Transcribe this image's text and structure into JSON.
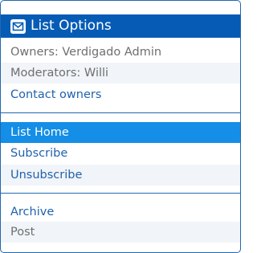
{
  "header": {
    "icon": "envelope-icon",
    "title": "List Options"
  },
  "info": {
    "owners": "Owners: Verdigado Admin",
    "moderators": "Moderators: Willi",
    "contact": "Contact owners"
  },
  "nav": {
    "home": "List Home",
    "subscribe": "Subscribe",
    "unsubscribe": "Unsubscribe"
  },
  "archive_section": {
    "archive": "Archive",
    "post": "Post"
  },
  "colors": {
    "header_bg": "#065bb5",
    "active_bg": "#148ee6",
    "link": "#1f62ad",
    "border": "#2068b0"
  }
}
